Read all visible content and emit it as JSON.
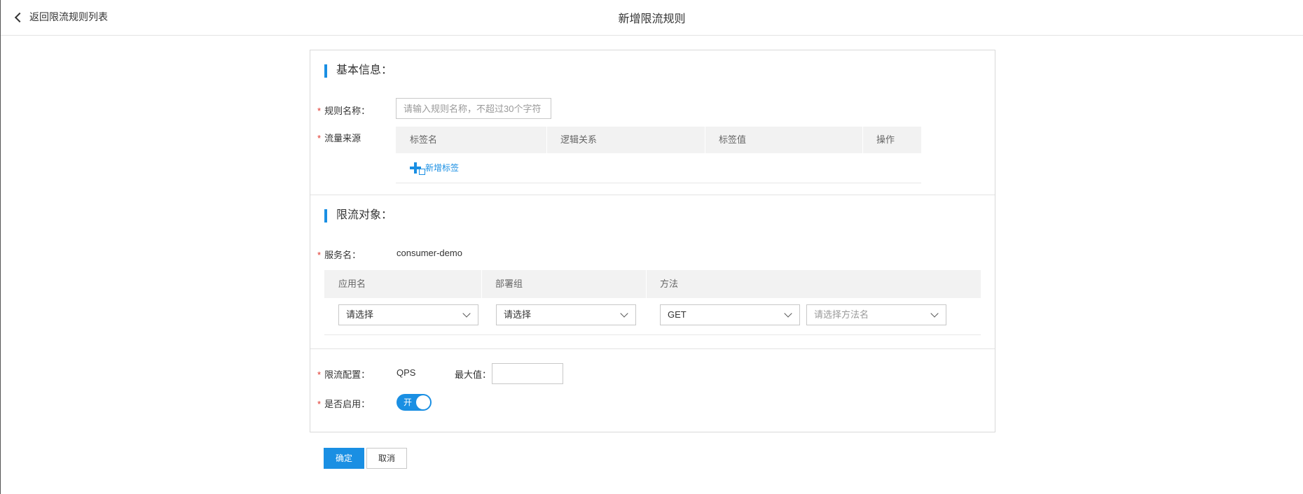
{
  "header": {
    "back_label": "返回限流规则列表",
    "title": "新增限流规则"
  },
  "basic": {
    "section_title": "基本信息：",
    "rule_name_label": "规则名称：",
    "rule_name_placeholder": "请输入规则名称，不超过30个字符",
    "rule_name_value": "",
    "traffic_source_label": "流量来源",
    "tag_columns": [
      "标签名",
      "逻辑关系",
      "标签值",
      "操作"
    ],
    "add_tag_label": "新增标签"
  },
  "target": {
    "section_title": "限流对象：",
    "service_label": "服务名：",
    "service_value": "consumer-demo",
    "columns": [
      "应用名",
      "部署组",
      "方法"
    ],
    "app_select": "请选择",
    "group_select": "请选择",
    "method_select": "GET",
    "method_name_placeholder": "请选择方法名"
  },
  "config": {
    "limit_label": "限流配置：",
    "qps_label": "QPS",
    "max_label": "最大值：",
    "max_value": "",
    "enable_label": "是否启用：",
    "toggle_label": "开",
    "toggle_on": true
  },
  "actions": {
    "confirm_label": "确定",
    "cancel_label": "取消"
  },
  "colors": {
    "accent": "#1a8fe3",
    "required": "#e0362c"
  }
}
